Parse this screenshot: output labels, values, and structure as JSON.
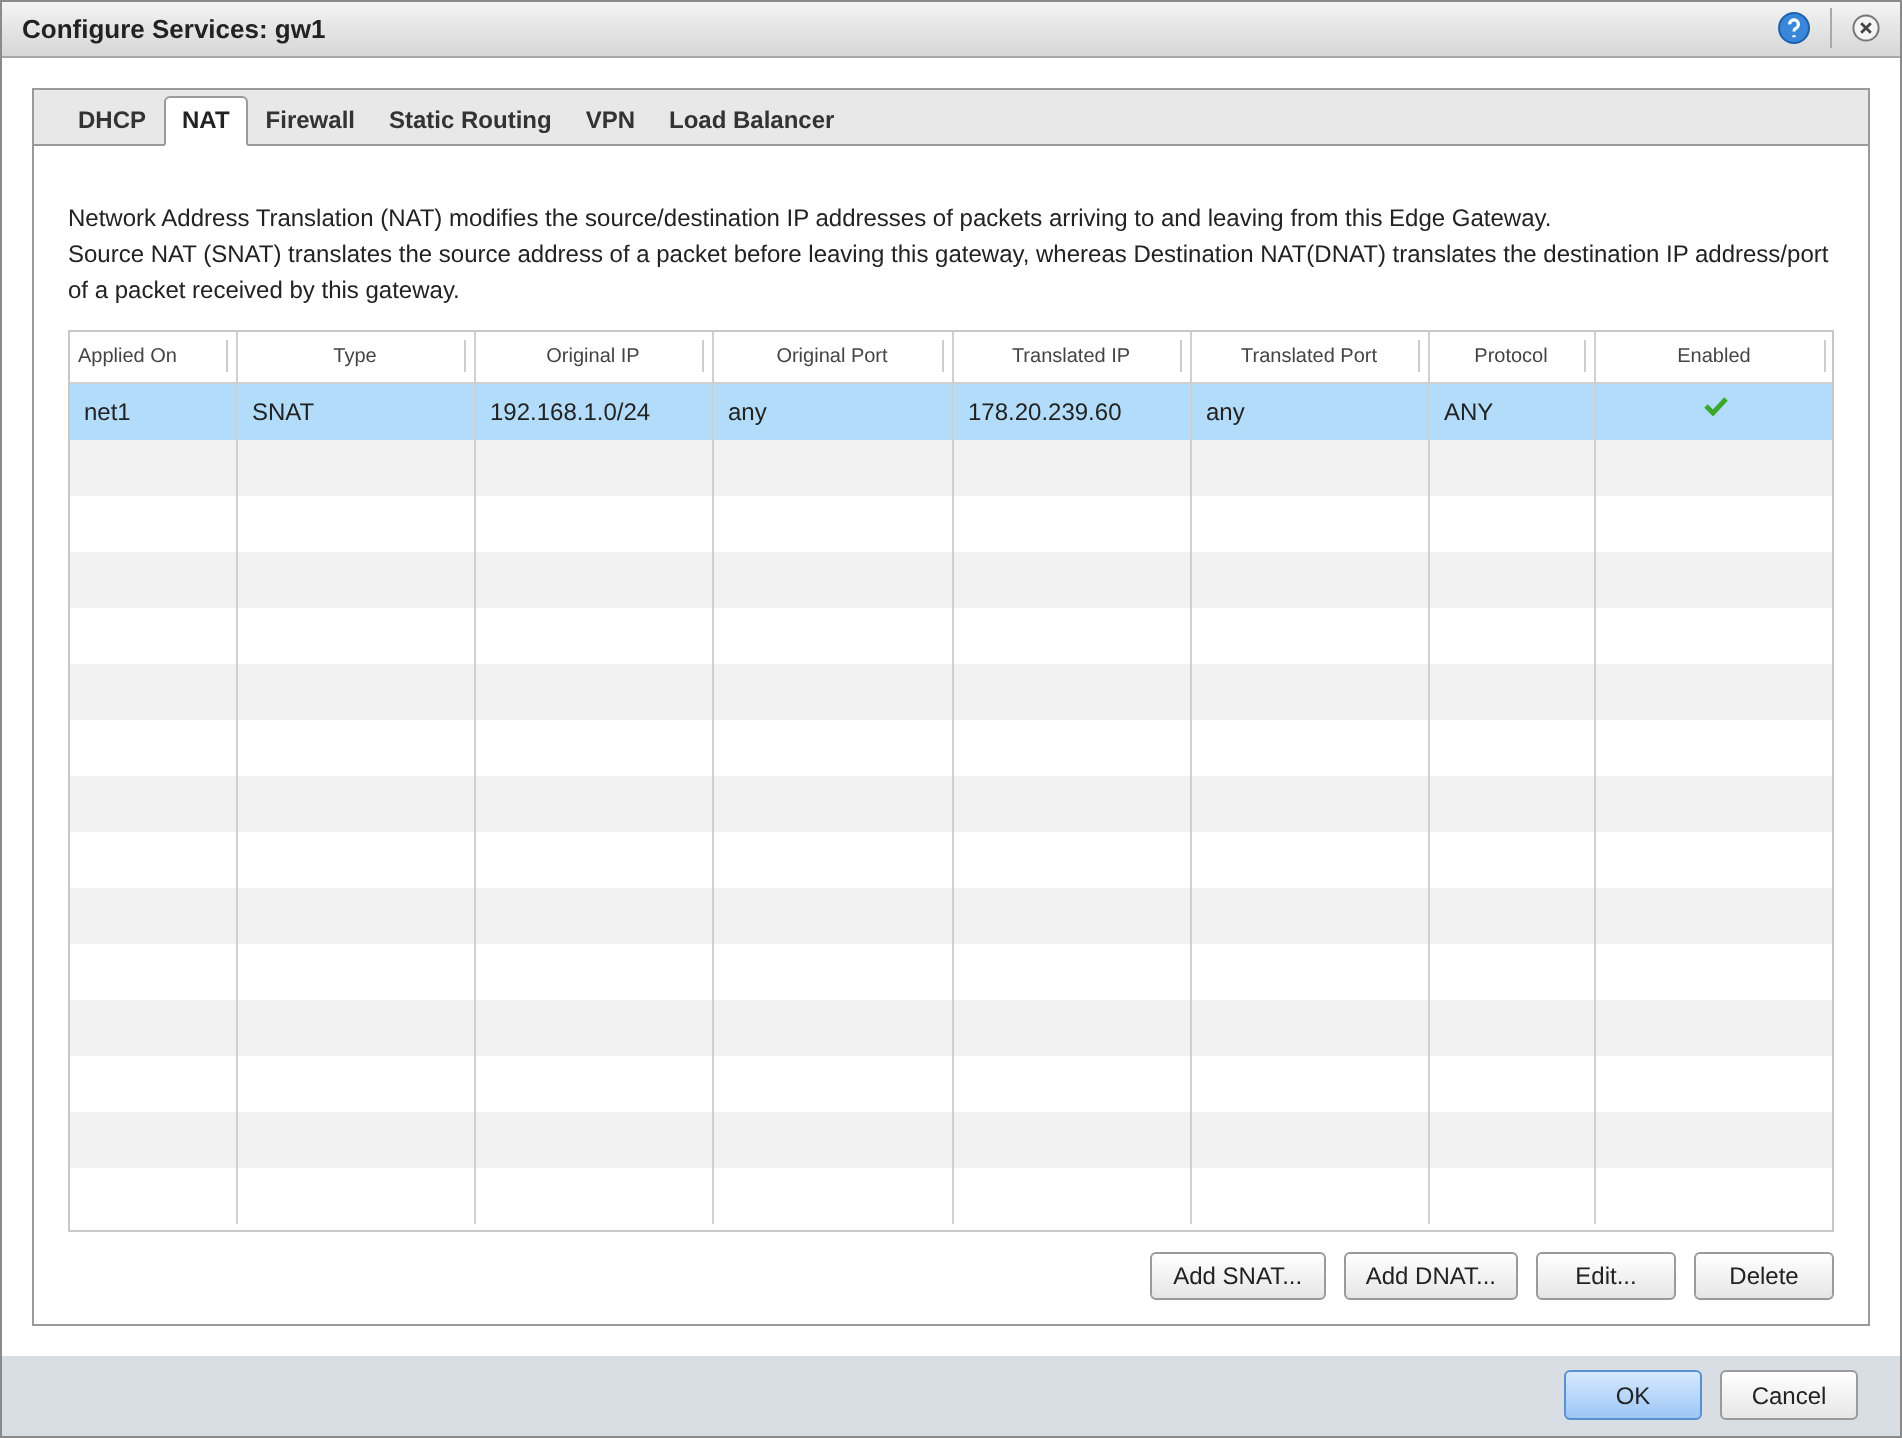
{
  "window": {
    "title": "Configure Services: gw1"
  },
  "tabs": [
    {
      "label": "DHCP",
      "selected": false
    },
    {
      "label": "NAT",
      "selected": true
    },
    {
      "label": "Firewall",
      "selected": false
    },
    {
      "label": "Static Routing",
      "selected": false
    },
    {
      "label": "VPN",
      "selected": false
    },
    {
      "label": "Load Balancer",
      "selected": false
    }
  ],
  "description": [
    "Network Address Translation (NAT) modifies the source/destination IP addresses of packets arriving to and leaving from this Edge Gateway.",
    "Source NAT (SNAT) translates the source address of a packet before leaving this gateway, whereas Destination NAT(DNAT)  translates the destination IP address/port of a packet received by this gateway."
  ],
  "table": {
    "columns": [
      "Applied On",
      "Type",
      "Original IP",
      "Original Port",
      "Translated IP",
      "Translated Port",
      "Protocol",
      "Enabled"
    ],
    "rows": [
      {
        "applied_on": "net1",
        "type": "SNAT",
        "original_ip": "192.168.1.0/24",
        "original_port": "any",
        "translated_ip": "178.20.239.60",
        "translated_port": "any",
        "protocol": "ANY",
        "enabled": true,
        "selected": true
      }
    ]
  },
  "table_buttons": [
    "Add SNAT...",
    "Add DNAT...",
    "Edit...",
    "Delete"
  ],
  "dialog_buttons": [
    {
      "label": "OK",
      "primary": true
    },
    {
      "label": "Cancel",
      "primary": false
    }
  ]
}
